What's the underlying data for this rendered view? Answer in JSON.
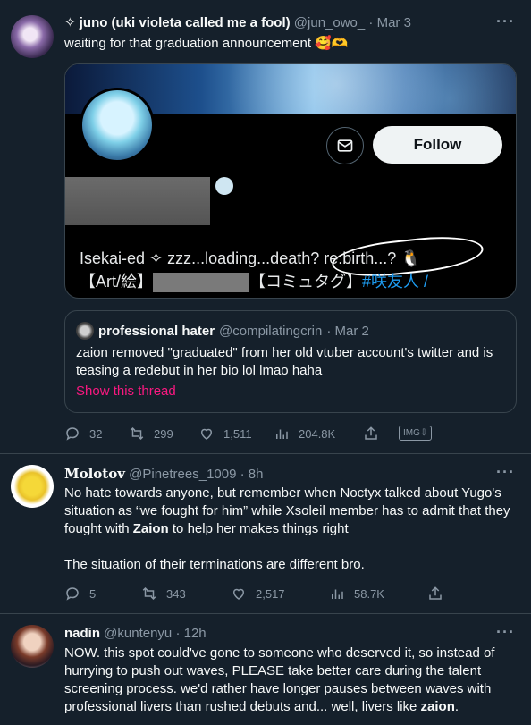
{
  "tweets": [
    {
      "name": "✧ juno (uki violeta called me a fool)",
      "handle": "@jun_owo_",
      "time": "· Mar 3",
      "text": "waiting for that graduation announcement 🥰🫶",
      "card": {
        "follow_label": "Follow",
        "bio_line1": "Isekai-ed ✧ zzz...loading...death? re:birth...? 🐧",
        "bio_line2_prefix": "【Art/絵】",
        "bio_line2_mid": "【コミュタグ】",
        "bio_line2_tag": "#咲友人 /"
      },
      "quote": {
        "name": "professional hater",
        "handle": "@compilatingcrin",
        "time": "· Mar 2",
        "text": "zaion removed \"graduated\" from her old vtuber account's twitter and is teasing a redebut in her bio lol lmao haha",
        "link": "Show this thread"
      },
      "stats": {
        "replies": "32",
        "retweets": "299",
        "likes": "1,511",
        "views": "204.8K",
        "img_badge": "IMG⇩"
      }
    },
    {
      "name": "Molotov",
      "handle": "@Pinetrees_1009",
      "time": "· 8h",
      "text1": "No hate towards anyone, but remember when Noctyx talked about Yugo's situation as “we fought for him” while Xsoleil member has to admit that they fought with ",
      "bold": "Zaion",
      "text1_end": " to help her makes things right",
      "text2": "The situation of their terminations are different bro.",
      "stats": {
        "replies": "5",
        "retweets": "343",
        "likes": "2,517",
        "views": "58.7K"
      }
    },
    {
      "name": "nadin",
      "handle": "@kuntenyu",
      "time": "· 12h",
      "text": "NOW. this spot could've gone to someone who deserved it, so instead of hurrying to push out waves, PLEASE take better care during the talent screening process. we'd rather have longer pauses between waves with professional livers than rushed debuts and... well, livers like ",
      "bold": "zaion",
      "text_end": "."
    }
  ],
  "more_icon_glyph": "···"
}
